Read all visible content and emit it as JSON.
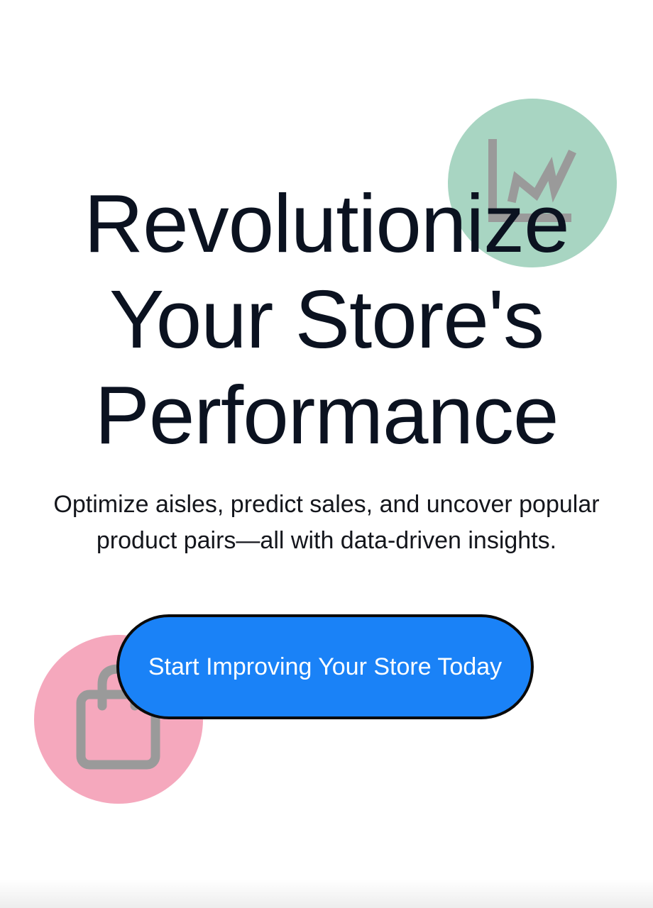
{
  "hero": {
    "title_lines": [
      "Revolutionize",
      "Your Store's",
      "Performance"
    ],
    "subtitle_lines": [
      "Optimize aisles, predict sales, and uncover popular",
      "product pairs—all with data-driven insights."
    ],
    "cta_label": "Start Improving Your Store Today"
  },
  "decorations": {
    "chart_badge": {
      "icon": "line-chart-icon",
      "circle_color": "#a8d5c2",
      "icon_color": "#9a9a9a"
    },
    "bag_badge": {
      "icon": "shopping-bag-icon",
      "circle_color": "#f5a8bd",
      "icon_color": "#9a9a9a"
    }
  },
  "colors": {
    "background": "#ffffff",
    "title_text": "#0b1220",
    "subtitle_text": "#14161c",
    "cta_background": "#1a82f7",
    "cta_border": "#0a0a0a",
    "cta_text": "#ffffff"
  }
}
